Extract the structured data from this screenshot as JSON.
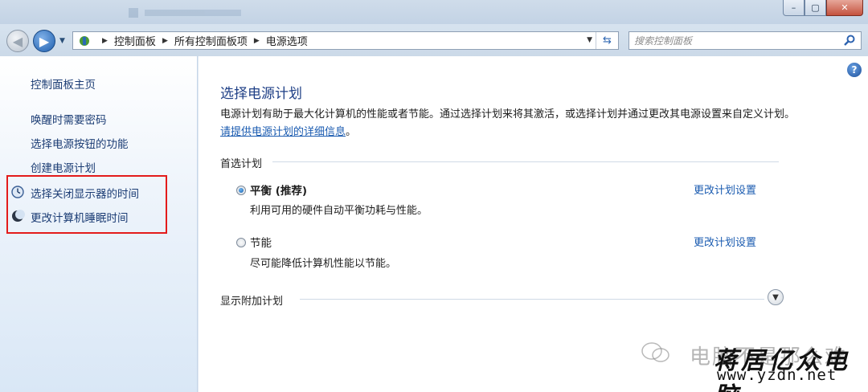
{
  "window": {
    "buttons": {
      "minimize": "–",
      "maximize": "▢",
      "close": "✕"
    }
  },
  "nav": {
    "back_glyph": "◀",
    "forward_glyph": "▶",
    "breadcrumbs": [
      "控制面板",
      "所有控制面板项",
      "电源选项"
    ],
    "search_placeholder": "搜索控制面板"
  },
  "sidebar": {
    "home": "控制面板主页",
    "items": [
      {
        "label": "唤醒时需要密码",
        "icon": ""
      },
      {
        "label": "选择电源按钮的功能",
        "icon": ""
      },
      {
        "label": "创建电源计划",
        "icon": ""
      },
      {
        "label": "选择关闭显示器的时间",
        "icon": "monitor-clock-icon"
      },
      {
        "label": "更改计算机睡眠时间",
        "icon": "moon-icon"
      }
    ]
  },
  "main": {
    "help": "?",
    "title": "选择电源计划",
    "description": "电源计划有助于最大化计算机的性能或者节能。通过选择计划来将其激活，或选择计划并通过更改其电源设置来自定义计划。",
    "description_link": "请提供电源计划的详细信息",
    "description_end": "。",
    "preferred_group": "首选计划",
    "plans": [
      {
        "name": "平衡 (推荐)",
        "desc": "利用可用的硬件自动平衡功耗与性能。",
        "link": "更改计划设置",
        "selected": true
      },
      {
        "name": "节能",
        "desc": "尽可能降低计算机性能以节能。",
        "link": "更改计划设置",
        "selected": false
      }
    ],
    "additional": "显示附加计划"
  },
  "watermark": {
    "text_faded": "电脑不是那么难",
    "text_brand": "蒋居亿众电脑",
    "url": "www.yzdn.net"
  },
  "colors": {
    "link": "#1a5bb0",
    "title": "#1e3f86",
    "highlight": "#e31b1b"
  }
}
